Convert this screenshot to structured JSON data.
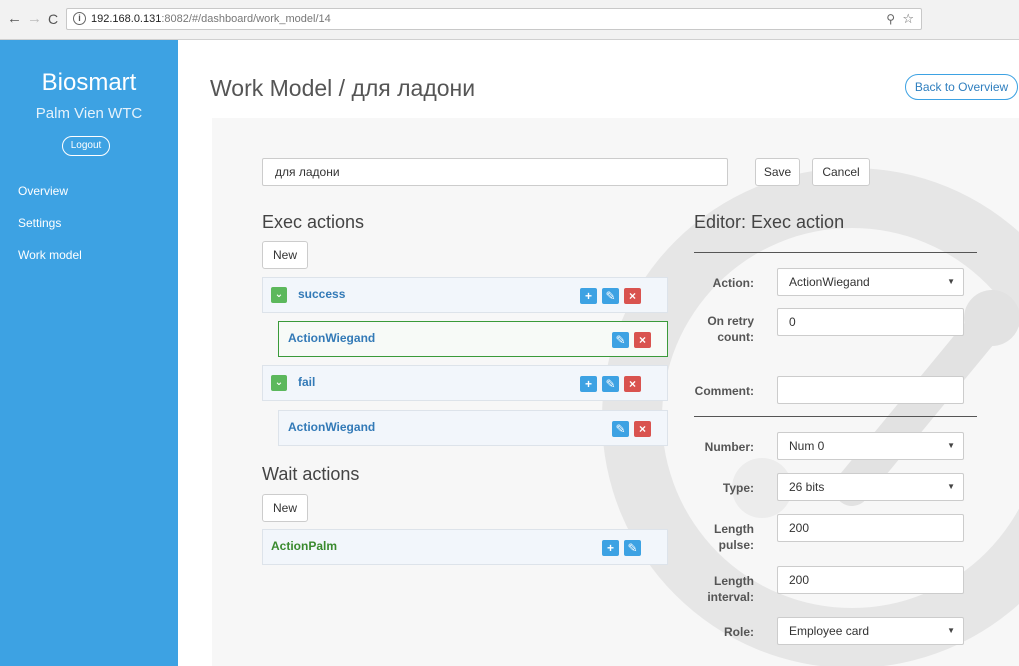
{
  "browser": {
    "url_host": "192.168.0.131",
    "url_path": ":8082/#/dashboard/work_model/14",
    "info_glyph": "i"
  },
  "sidebar": {
    "brand": "Biosmart",
    "subtitle": "Palm Vien WTC",
    "logout": "Logout",
    "items": [
      {
        "label": "Overview"
      },
      {
        "label": "Settings"
      },
      {
        "label": "Work model"
      }
    ]
  },
  "header": {
    "title": "Work Model / для ладони",
    "back": "Back to Overview"
  },
  "form": {
    "name_value": "для ладони",
    "save": "Save",
    "cancel": "Cancel"
  },
  "exec": {
    "title": "Exec actions",
    "new": "New",
    "groups": [
      {
        "label": "success",
        "child": "ActionWiegand"
      },
      {
        "label": "fail",
        "child": "ActionWiegand"
      }
    ]
  },
  "wait": {
    "title": "Wait actions",
    "new": "New",
    "items": [
      {
        "label": "ActionPalm"
      }
    ]
  },
  "editor": {
    "title": "Editor: Exec action",
    "fields": {
      "action": {
        "label": "Action:",
        "value": "ActionWiegand"
      },
      "retry": {
        "label": "On retry count:",
        "value": "0"
      },
      "comment": {
        "label": "Comment:",
        "value": ""
      },
      "number": {
        "label": "Number:",
        "value": "Num 0"
      },
      "type": {
        "label": "Type:",
        "value": "26 bits"
      },
      "pulse": {
        "label": "Length pulse:",
        "value": "200"
      },
      "interval": {
        "label": "Length interval:",
        "value": "200"
      },
      "role": {
        "label": "Role:",
        "value": "Employee card"
      }
    }
  },
  "colors": {
    "sidebar": "#3da2e3",
    "accent_blue": "#3da2e3",
    "danger": "#d9534f",
    "success": "#5cb85c",
    "selected_border": "#3a9a3a"
  },
  "icons": [
    "back-arrow-icon",
    "forward-arrow-icon",
    "reload-icon",
    "info-icon",
    "key-icon",
    "star-icon",
    "chevron-down-icon",
    "plus-icon",
    "edit-icon",
    "delete-icon",
    "caret-down-icon",
    "watermark-logo-icon"
  ]
}
